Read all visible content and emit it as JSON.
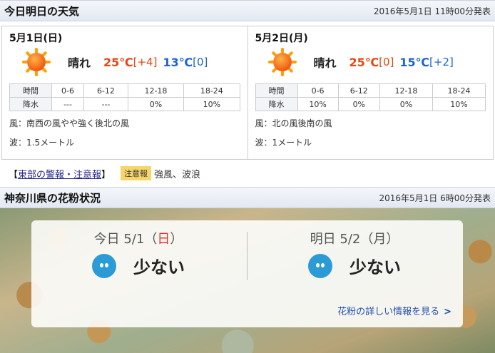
{
  "weather": {
    "title": "今日明日の天気",
    "issued": "2016年5月1日 11時00分発表",
    "days": [
      {
        "date": "5月1日(日)",
        "icon": "sun-icon",
        "condition": "晴れ",
        "high": "25℃",
        "high_diff": "[+4]",
        "low": "13℃",
        "low_diff": "[0]",
        "rain_table": {
          "row_time_label": "時間",
          "row_rain_label": "降水",
          "periods": [
            "0-6",
            "6-12",
            "12-18",
            "18-24"
          ],
          "values": [
            "---",
            "---",
            "0%",
            "10%"
          ]
        },
        "wind": "風：南西の風やや強く後北の風",
        "wave": "波：1.5メートル"
      },
      {
        "date": "5月2日(月)",
        "icon": "sun-icon",
        "condition": "晴れ",
        "high": "25℃",
        "high_diff": "[0]",
        "low": "15℃",
        "low_diff": "[+2]",
        "rain_table": {
          "row_time_label": "時間",
          "row_rain_label": "降水",
          "periods": [
            "0-6",
            "6-12",
            "12-18",
            "18-24"
          ],
          "values": [
            "10%",
            "0%",
            "0%",
            "10%"
          ]
        },
        "wind": "風：北の風後南の風",
        "wave": "波：1メートル"
      }
    ],
    "warning": {
      "bracket_open": "【",
      "link": "東部の警報・注意報",
      "bracket_close": "】",
      "badge": "注意報",
      "items": "強風、波浪"
    }
  },
  "pollen": {
    "title": "神奈川県の花粉状況",
    "issued": "2016年5月1日 6時00分発表",
    "today": {
      "label": "今日",
      "date": "5/1",
      "weekday_open": "（",
      "weekday": "日",
      "weekday_close": "）",
      "level": "少ない"
    },
    "tomorrow": {
      "label": "明日",
      "date": "5/2（月）",
      "level": "少ない"
    },
    "more_link": "花粉の詳しい情報を見る",
    "face_color": "#2b9bd6"
  },
  "colors": {
    "high": "#e84510",
    "low": "#1d64d0",
    "badge": "#f6d66a"
  }
}
